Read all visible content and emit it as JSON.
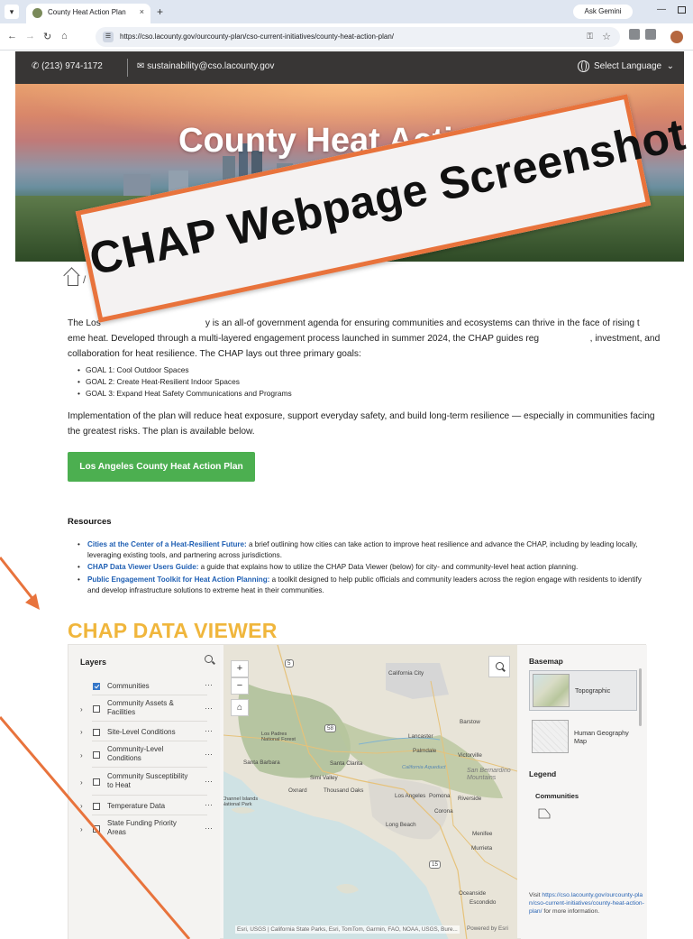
{
  "browser": {
    "tab_title": "County Heat Action Plan",
    "tab_close": "×",
    "new_tab": "+",
    "ask_gemini": "Ask Gemini",
    "url": "https://cso.lacounty.gov/ourcounty-plan/cso-current-initiatives/county-heat-action-plan/",
    "win_min": "—"
  },
  "topbar": {
    "phone": "(213) 974-1172",
    "email": "sustainability@cso.lacounty.gov",
    "language": "Select Language"
  },
  "hero": {
    "title": "County Heat Action Pl"
  },
  "overlay": {
    "banner_text": "CHAP Webpage Screenshot",
    "accent": "#e8733c"
  },
  "content": {
    "breadcrumb_sep": "/",
    "intro": "The Los                                         y is an all-of government agenda for ensuring communities and ecosystems can thrive in the face of rising t                   eme heat. Developed through a multi-layered engagement process launched in summer 2024, the CHAP guides reg                    , investment, and collaboration for heat resilience. The CHAP lays out three primary goals:",
    "goals": [
      "GOAL 1: Cool Outdoor Spaces",
      "GOAL 2: Create Heat-Resilient Indoor Spaces",
      "GOAL 3: Expand Heat Safety Communications and Programs"
    ],
    "implementation": "Implementation of the plan will reduce heat exposure, support everyday safety, and build long-term resilience — especially in communities facing the greatest risks. The plan is available below.",
    "plan_button": "Los Angeles County Heat Action Plan",
    "resources_heading": "Resources",
    "resources": [
      {
        "link": "Cities at the Center of a Heat-Resilient Future:",
        "text": " a brief outlining how cities can take action to improve heat resilience and advance the CHAP, including by leading locally, leveraging existing tools, and partnering across jurisdictions."
      },
      {
        "link": "CHAP Data Viewer Users Guide:",
        "text": " a guide that explains how to utilize the CHAP Data Viewer (below) for city- and community-level heat action planning."
      },
      {
        "link": "Public Engagement Toolkit for Heat Action Planning:",
        "text": " a toolkit designed to help public officials and community leaders across the region engage with residents to identify and develop infrastructure solutions to extreme heat in their communities."
      }
    ],
    "data_viewer_title": "CHAP DATA VIEWER"
  },
  "viewer": {
    "layers_heading": "Layers",
    "more": "···",
    "layers": [
      {
        "label": "Communities",
        "checked": true,
        "expandable": false
      },
      {
        "label": "Community Assets & Facilities",
        "checked": false,
        "expandable": true
      },
      {
        "label": "Site-Level Conditions",
        "checked": false,
        "expandable": true
      },
      {
        "label": "Community-Level Conditions",
        "checked": false,
        "expandable": true
      },
      {
        "label": "Community Susceptibility to Heat",
        "checked": false,
        "expandable": true
      },
      {
        "label": "Temperature Data",
        "checked": false,
        "expandable": true
      },
      {
        "label": "State Funding Priority Areas",
        "checked": false,
        "expandable": true
      }
    ],
    "map": {
      "zoom_in": "+",
      "zoom_out": "−",
      "cities": [
        "California City",
        "Barstow",
        "Lancaster",
        "Palmdale",
        "Victorville",
        "Los Padres National Forest",
        "Santa Barbara",
        "Santa Clarita",
        "Simi Valley",
        "Oxnard",
        "Thousand Oaks",
        "Los Angeles",
        "Pomona",
        "Riverside",
        "Corona",
        "Long Beach",
        "Menifee",
        "Murrieta",
        "Oceanside",
        "Escondido",
        "San Bernardino Mountains",
        "Channel Islands National Park",
        "California Aqueduct"
      ],
      "route_shields": [
        "5",
        "58",
        "15"
      ],
      "attribution": "Esri, USGS | California State Parks, Esri, TomTom, Garmin, FAO, NOAA, USGS, Bure...",
      "powered": "Powered by Esri"
    },
    "basemap_heading": "Basemap",
    "basemaps": [
      "Topographic",
      "Human Geography Map"
    ],
    "legend_heading": "Legend",
    "legend_layer": "Communities",
    "visit_prefix": "Visit ",
    "visit_link": "https://cso.lacounty.gov/ourcounty-plan/cso-current-initiatives/county-heat-action-plan/",
    "visit_suffix": " for more information."
  }
}
